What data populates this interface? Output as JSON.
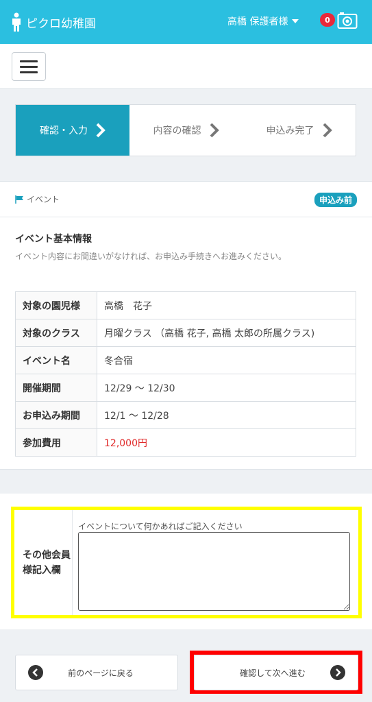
{
  "header": {
    "app_title": "ピクロ幼稚園",
    "user_label": "高橋 保護者様",
    "notification_count": "0"
  },
  "steps": [
    {
      "label": "確認・入力",
      "active": true
    },
    {
      "label": "内容の確認",
      "active": false
    },
    {
      "label": "申込み完了",
      "active": false
    }
  ],
  "card": {
    "category": "イベント",
    "status": "申込み前",
    "section_title": "イベント基本情報",
    "section_desc": "イベント内容にお間違いがなければ、お申込み手続きへお進みください。",
    "rows": [
      {
        "key": "対象の園児様",
        "value": "高橋　花子"
      },
      {
        "key": "対象のクラス",
        "value": "月曜クラス （高橋 花子, 高橋 太郎の所属クラス)"
      },
      {
        "key": "イベント名",
        "value": "冬合宿"
      },
      {
        "key": "開催期間",
        "value": "12/29 〜 12/30"
      },
      {
        "key": "お申込み期間",
        "value": "12/1 〜 12/28"
      },
      {
        "key": "参加費用",
        "value": "12,000円"
      }
    ]
  },
  "remarks": {
    "label": "その他会員様記入欄",
    "hint": "イベントについて何かあればご記入ください",
    "value": ""
  },
  "buttons": {
    "back": "前のページに戻る",
    "next": "確認して次へ進む"
  },
  "colors": {
    "header": "#2bbfe0",
    "active_step": "#1aa0bd",
    "price": "#e02a2a",
    "highlight_yellow": "#ffff00",
    "highlight_red": "#ff0000"
  }
}
